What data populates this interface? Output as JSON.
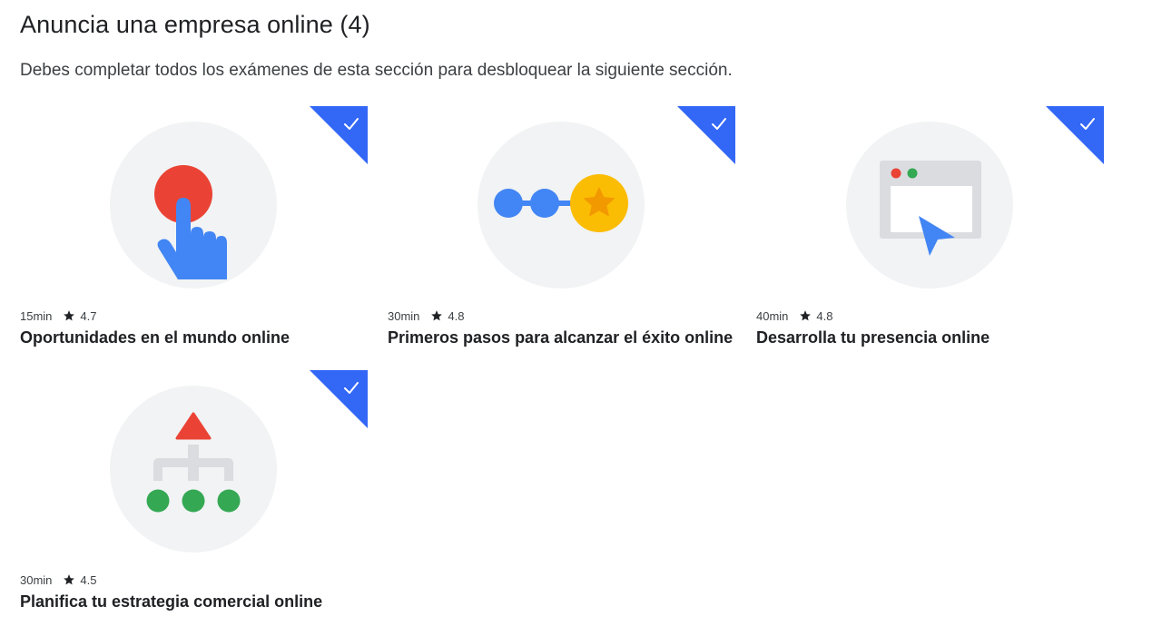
{
  "section": {
    "title": "Anuncia una empresa online (4)",
    "description": "Debes completar todos los exámenes de esta sección para desbloquear la siguiente sección."
  },
  "colors": {
    "badge": "#3367f6",
    "blue": "#4285f4",
    "red": "#ea4335",
    "yellow": "#fbbc04",
    "green": "#34a853",
    "circle_bg": "#f1f3f4"
  },
  "courses": [
    {
      "duration": "15min",
      "rating": "4.7",
      "title": "Oportunidades en el mundo online",
      "completed": true,
      "icon": "tap-hand-icon"
    },
    {
      "duration": "30min",
      "rating": "4.8",
      "title": "Primeros pasos para alcanzar el éxito online",
      "completed": true,
      "icon": "progress-star-icon"
    },
    {
      "duration": "40min",
      "rating": "4.8",
      "title": "Desarrolla tu presencia online",
      "completed": true,
      "icon": "browser-cursor-icon"
    },
    {
      "duration": "30min",
      "rating": "4.5",
      "title": "Planifica tu estrategia comercial online",
      "completed": true,
      "icon": "strategy-tree-icon"
    }
  ]
}
